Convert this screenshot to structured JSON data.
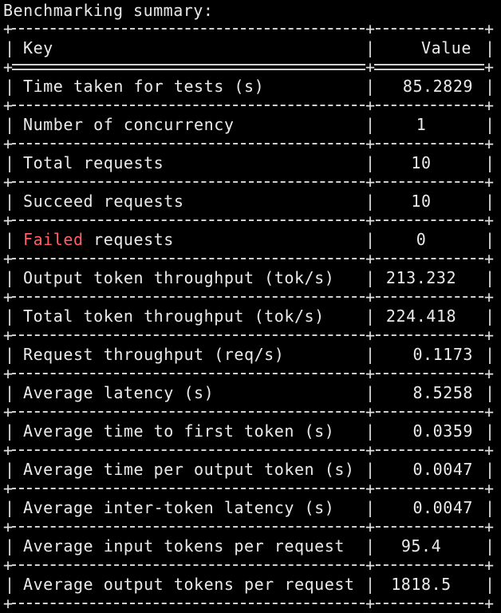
{
  "terminal": {
    "title": "Benchmarking summary:",
    "accent_red": "#ff5f66"
  },
  "table": {
    "header": {
      "key": "Key",
      "value": "Value"
    },
    "rows": [
      {
        "key": "Time taken for tests (s)",
        "value": "85.2829",
        "align": "right"
      },
      {
        "key": "Number of concurrency",
        "value": "1",
        "align": "center"
      },
      {
        "key": "Total requests",
        "value": "10",
        "align": "center"
      },
      {
        "key": "Succeed requests",
        "value": "10",
        "align": "center"
      },
      {
        "key_highlight": "Failed",
        "key_rest": " requests",
        "value": "0",
        "align": "center"
      },
      {
        "key": "Output token throughput (tok/s)",
        "value": "213.232",
        "align": "center"
      },
      {
        "key": "Total token throughput (tok/s)",
        "value": "224.418",
        "align": "center"
      },
      {
        "key": "Request throughput (req/s)",
        "value": "0.1173",
        "align": "right"
      },
      {
        "key": "Average latency (s)",
        "value": "8.5258",
        "align": "right"
      },
      {
        "key": "Average time to first token (s)",
        "value": "0.0359",
        "align": "right"
      },
      {
        "key": "Average time per output token (s)",
        "value": "0.0047",
        "align": "right"
      },
      {
        "key": "Average inter-token latency (s)",
        "value": "0.0047",
        "align": "right"
      },
      {
        "key": "Average input tokens per request",
        "value": "95.4",
        "align": "center"
      },
      {
        "key": "Average output tokens per request",
        "value": "1818.5",
        "align": "center"
      }
    ]
  }
}
